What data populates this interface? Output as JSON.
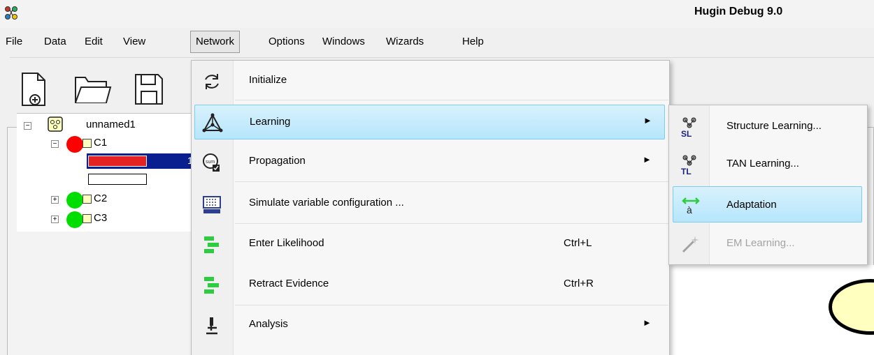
{
  "window": {
    "title": "Hugin Debug 9.0"
  },
  "menubar": {
    "items": [
      {
        "label": "File"
      },
      {
        "label": "Data"
      },
      {
        "label": "Edit"
      },
      {
        "label": "View"
      },
      {
        "label": "Network"
      },
      {
        "label": "Options"
      },
      {
        "label": "Windows"
      },
      {
        "label": "Wizards"
      },
      {
        "label": "Help"
      }
    ]
  },
  "network_menu": {
    "items": [
      {
        "label": "Initialize",
        "shortcut": "",
        "icon": "refresh-icon"
      },
      {
        "label": "Learning",
        "shortcut": "",
        "icon": "learning-triangle-icon",
        "submenu": true,
        "highlighted": true
      },
      {
        "label": "Propagation",
        "shortcut": "",
        "icon": "propagation-icon",
        "submenu": true
      },
      {
        "label": "Simulate variable configuration ...",
        "shortcut": "",
        "icon": "simulate-icon"
      },
      {
        "label": "Enter Likelihood",
        "shortcut": "Ctrl+L",
        "icon": "enter-likelihood-icon"
      },
      {
        "label": "Retract Evidence",
        "shortcut": "Ctrl+R",
        "icon": "retract-evidence-icon"
      },
      {
        "label": "Analysis",
        "shortcut": "",
        "icon": "microscope-icon",
        "submenu": true
      }
    ]
  },
  "learning_submenu": {
    "items": [
      {
        "label": "Structure Learning...",
        "icon": "structure-learning-icon",
        "enabled": true
      },
      {
        "label": "TAN Learning...",
        "icon": "tan-learning-icon",
        "enabled": true
      },
      {
        "label": "Adaptation",
        "icon": "adaptation-icon",
        "enabled": true,
        "highlighted": true
      },
      {
        "label": "EM Learning...",
        "icon": "em-learning-icon",
        "enabled": false
      }
    ]
  },
  "tree": {
    "root": "unnamed1",
    "nodes": [
      {
        "label": "C1",
        "expanded": true
      },
      {
        "label": "C2",
        "expanded": false
      },
      {
        "label": "C3",
        "expanded": false
      }
    ],
    "state_value": "1"
  },
  "colors": {
    "highlight_top": "#d8f1fd",
    "highlight_bottom": "#b6e6fb",
    "highlight_border": "#7ccbf0",
    "node_red": "#ff0000",
    "node_green": "#00dd00",
    "selection_blue": "#0a1f8f"
  }
}
